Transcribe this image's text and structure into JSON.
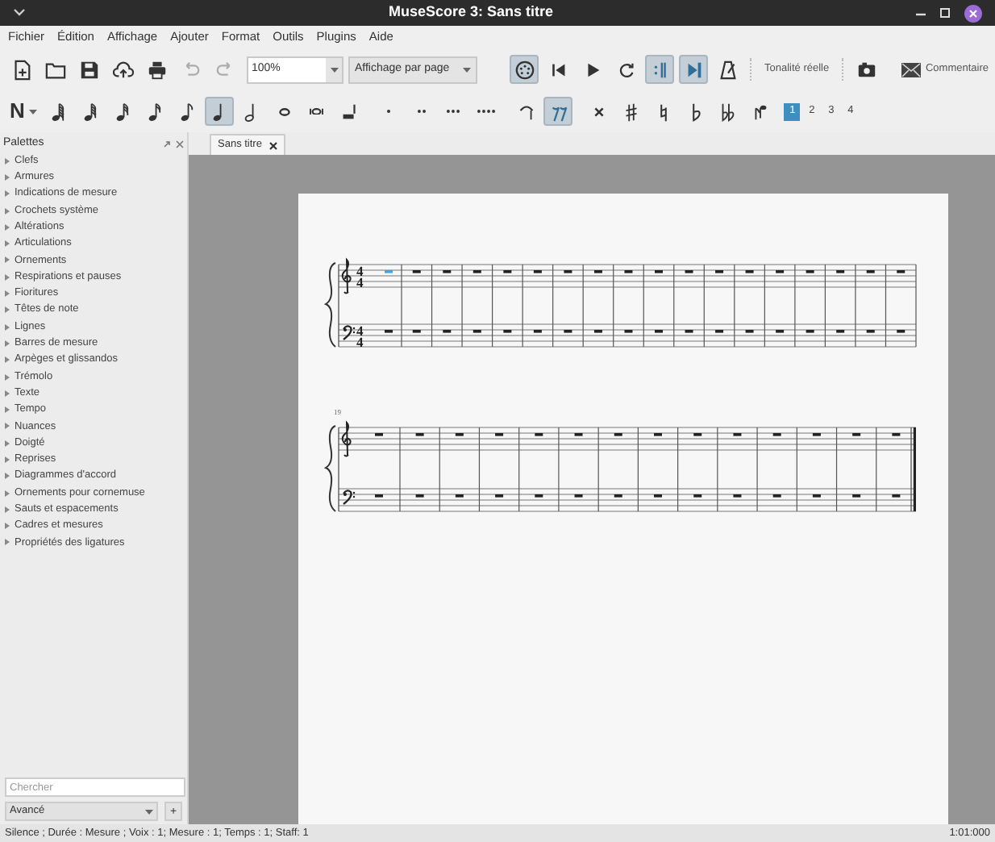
{
  "window": {
    "title": "MuseScore 3: Sans titre"
  },
  "menu": [
    "Fichier",
    "Édition",
    "Affichage",
    "Ajouter",
    "Format",
    "Outils",
    "Plugins",
    "Aide"
  ],
  "file_toolbar": [
    {
      "kind": "new",
      "disabled": false
    },
    {
      "kind": "open",
      "disabled": false
    },
    {
      "kind": "save",
      "disabled": false
    },
    {
      "kind": "upload",
      "disabled": false
    },
    {
      "kind": "print",
      "disabled": false
    },
    {
      "kind": "undo",
      "disabled": true
    },
    {
      "kind": "redo",
      "disabled": true
    }
  ],
  "zoom": {
    "value": "100%"
  },
  "view_mode": {
    "value": "Affichage par page"
  },
  "playback_toolbar": [
    {
      "kind": "mixer",
      "selected": true
    },
    {
      "kind": "rewind",
      "selected": false
    },
    {
      "kind": "play",
      "selected": false
    },
    {
      "kind": "loop",
      "selected": false
    },
    {
      "kind": "repeat",
      "selected": true
    },
    {
      "kind": "pan",
      "selected": true
    },
    {
      "kind": "metronome",
      "selected": false
    }
  ],
  "concert_pitch": {
    "label": "Tonalité réelle"
  },
  "feedback": {
    "label": "Commentaire"
  },
  "note_input": {
    "label": "N"
  },
  "note_toolbar": [
    {
      "kind": "n128",
      "selected": false
    },
    {
      "kind": "n64",
      "selected": false
    },
    {
      "kind": "n32",
      "selected": false
    },
    {
      "kind": "n16",
      "selected": false
    },
    {
      "kind": "n8",
      "selected": false
    },
    {
      "kind": "n4",
      "selected": true
    },
    {
      "kind": "n2",
      "selected": false
    },
    {
      "kind": "n1",
      "selected": false
    },
    {
      "kind": "breve",
      "selected": false
    },
    {
      "kind": "longa",
      "selected": false
    },
    {
      "kind": "dot1",
      "selected": false
    },
    {
      "kind": "dot2",
      "selected": false
    },
    {
      "kind": "dot3",
      "selected": false
    },
    {
      "kind": "dot4",
      "selected": false
    },
    {
      "kind": "tie",
      "selected": false
    },
    {
      "kind": "rest",
      "selected": true
    },
    {
      "kind": "sharp2",
      "selected": false
    },
    {
      "kind": "sharp",
      "selected": false
    },
    {
      "kind": "natural",
      "selected": false
    },
    {
      "kind": "flat",
      "selected": false
    },
    {
      "kind": "flat2",
      "selected": false
    },
    {
      "kind": "flip",
      "selected": false
    }
  ],
  "voices": [
    {
      "label": "1",
      "selected": true
    },
    {
      "label": "2",
      "selected": false
    },
    {
      "label": "3",
      "selected": false
    },
    {
      "label": "4",
      "selected": false
    }
  ],
  "palettes": {
    "title": "Palettes",
    "items": [
      "Clefs",
      "Armures",
      "Indications de mesure",
      "Crochets système",
      "Altérations",
      "Articulations",
      "Ornements",
      "Respirations et pauses",
      "Fioritures",
      "Têtes de note",
      "Lignes",
      "Barres de mesure",
      "Arpèges et glissandos",
      "Trémolo",
      "Texte",
      "Tempo",
      "Nuances",
      "Doigté",
      "Reprises",
      "Diagrammes d'accord",
      "Ornements pour cornemuse",
      "Sauts et espacements",
      "Cadres et mesures",
      "Propriétés des ligatures"
    ],
    "search": {
      "placeholder": "Chercher"
    },
    "mode": {
      "value": "Avancé"
    },
    "add_label": "+"
  },
  "tabs": [
    {
      "label": "Sans titre",
      "selected": true
    }
  ],
  "score": {
    "systems": [
      {
        "staves": [
          {
            "kind": "treble",
            "time_signature": {
              "numerator": "4",
              "denominator": "4"
            },
            "rests": [
              {
                "selected": true
              },
              {
                "selected": false
              },
              {
                "selected": false
              },
              {
                "selected": false
              },
              {
                "selected": false
              },
              {
                "selected": false
              },
              {
                "selected": false
              },
              {
                "selected": false
              },
              {
                "selected": false
              },
              {
                "selected": false
              },
              {
                "selected": false
              },
              {
                "selected": false
              },
              {
                "selected": false
              },
              {
                "selected": false
              },
              {
                "selected": false
              },
              {
                "selected": false
              },
              {
                "selected": false
              },
              {
                "selected": false
              }
            ]
          },
          {
            "kind": "bass",
            "time_signature": {
              "numerator": "4",
              "denominator": "4"
            },
            "rests": [
              {
                "selected": false
              },
              {
                "selected": false
              },
              {
                "selected": false
              },
              {
                "selected": false
              },
              {
                "selected": false
              },
              {
                "selected": false
              },
              {
                "selected": false
              },
              {
                "selected": false
              },
              {
                "selected": false
              },
              {
                "selected": false
              },
              {
                "selected": false
              },
              {
                "selected": false
              },
              {
                "selected": false
              },
              {
                "selected": false
              },
              {
                "selected": false
              },
              {
                "selected": false
              },
              {
                "selected": false
              },
              {
                "selected": false
              }
            ]
          }
        ]
      },
      {
        "measure_number": "19",
        "final_barline": true,
        "staves": [
          {
            "kind": "treble",
            "rests": [
              {
                "selected": false
              },
              {
                "selected": false
              },
              {
                "selected": false
              },
              {
                "selected": false
              },
              {
                "selected": false
              },
              {
                "selected": false
              },
              {
                "selected": false
              },
              {
                "selected": false
              },
              {
                "selected": false
              },
              {
                "selected": false
              },
              {
                "selected": false
              },
              {
                "selected": false
              },
              {
                "selected": false
              },
              {
                "selected": false
              }
            ]
          },
          {
            "kind": "bass",
            "rests": [
              {
                "selected": false
              },
              {
                "selected": false
              },
              {
                "selected": false
              },
              {
                "selected": false
              },
              {
                "selected": false
              },
              {
                "selected": false
              },
              {
                "selected": false
              },
              {
                "selected": false
              },
              {
                "selected": false
              },
              {
                "selected": false
              },
              {
                "selected": false
              },
              {
                "selected": false
              },
              {
                "selected": false
              },
              {
                "selected": false
              }
            ]
          }
        ]
      }
    ]
  },
  "status_bar": {
    "text": "Silence ; Durée : Mesure ; Voix : 1; Mesure : 1; Temps : 1; Staff: 1",
    "position": "1:01:000"
  }
}
